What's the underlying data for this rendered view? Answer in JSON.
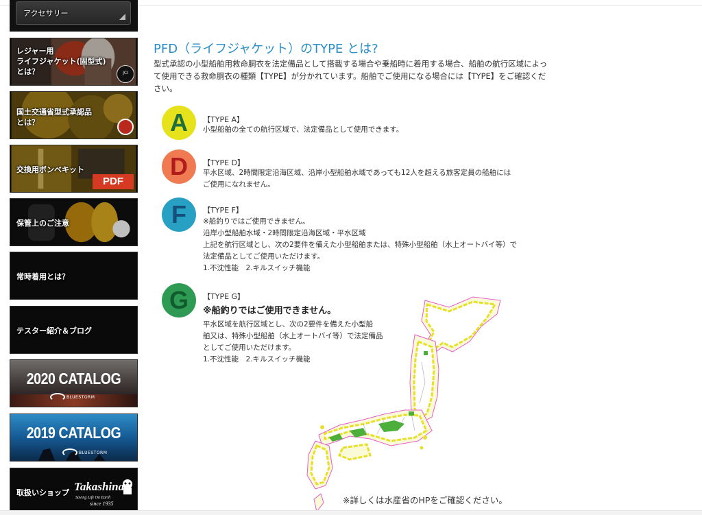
{
  "sidebar": {
    "accessory_label": "アクセサリー",
    "items": [
      {
        "label": "レジャー用\nライフジャケット(固型式)\nとは？",
        "badge_text": "JCI"
      },
      {
        "label": "国土交通省型式承認品\nとは？"
      },
      {
        "label": "交換用ボンベキット",
        "pdf": "PDF"
      },
      {
        "label": "保管上のご注意"
      },
      {
        "label": "常時着用とは？"
      },
      {
        "label": "テスター紹介＆ブログ"
      },
      {
        "label": "2020 CATALOG",
        "brand": "BLUESTORM"
      },
      {
        "label": "2019 CATALOG",
        "brand": "BLUESTORM"
      },
      {
        "label": "取扱いショップ",
        "brand": "Takashina",
        "brand_sub": "Saving Life On Earth",
        "brand_since": "since 1935"
      }
    ]
  },
  "main": {
    "title": "PFD（ライフジャケット）のTYPE とは?",
    "intro": "型式承認の小型船舶用救命胴衣を法定備品として搭載する場合や乗船時に着用する場合、船舶の航行区域によって使用できる救命胴衣の種類【TYPE】が分かれています。船舶でご使用になる場合には【TYPE】をご確認ください。",
    "types": [
      {
        "letter": "A",
        "title": "【TYPE A】",
        "desc": "小型船舶の全ての航行区域で、法定備品として使用できます。",
        "color": "#e6e21b",
        "text_color": "#1f6e3d"
      },
      {
        "letter": "D",
        "title": "【TYPE D】",
        "desc": "平水区域、2時間限定沿海区域、沿岸小型船舶水域であっても12人を超える旅客定員の船舶には\nご使用になれません。",
        "color": "#f07a52",
        "text_color": "#b01b1b"
      },
      {
        "letter": "F",
        "title": "【TYPE F】",
        "desc": "※船釣りではご使用できません。\n沿岸小型船舶水域・2時間限定沿海区域・平水区域\n上記を航行区域とし、次の2要件を備えた小型船舶または、特殊小型船舶（水上オートバイ等）で\n法定備品としてご使用いただけます。\n1.不沈性能　2.キルスイッチ機能",
        "color": "#27a0c4",
        "text_color": "#14507a"
      },
      {
        "letter": "G",
        "title": "【TYPE G】",
        "warning": "※船釣りではご使用できません。",
        "desc": "平水区域を航行区域とし、次の2要件を備えた小型船\n舶又は、特殊小型船舶（水上オートバイ等）で法定備品\nとしてご使用いただけます。\n1.不沈性能　2.キルスイッチ機能",
        "color": "#2f9a54",
        "text_color": "#115c2c"
      }
    ],
    "note": "※詳しくは水産省のHPをご確認ください。"
  }
}
